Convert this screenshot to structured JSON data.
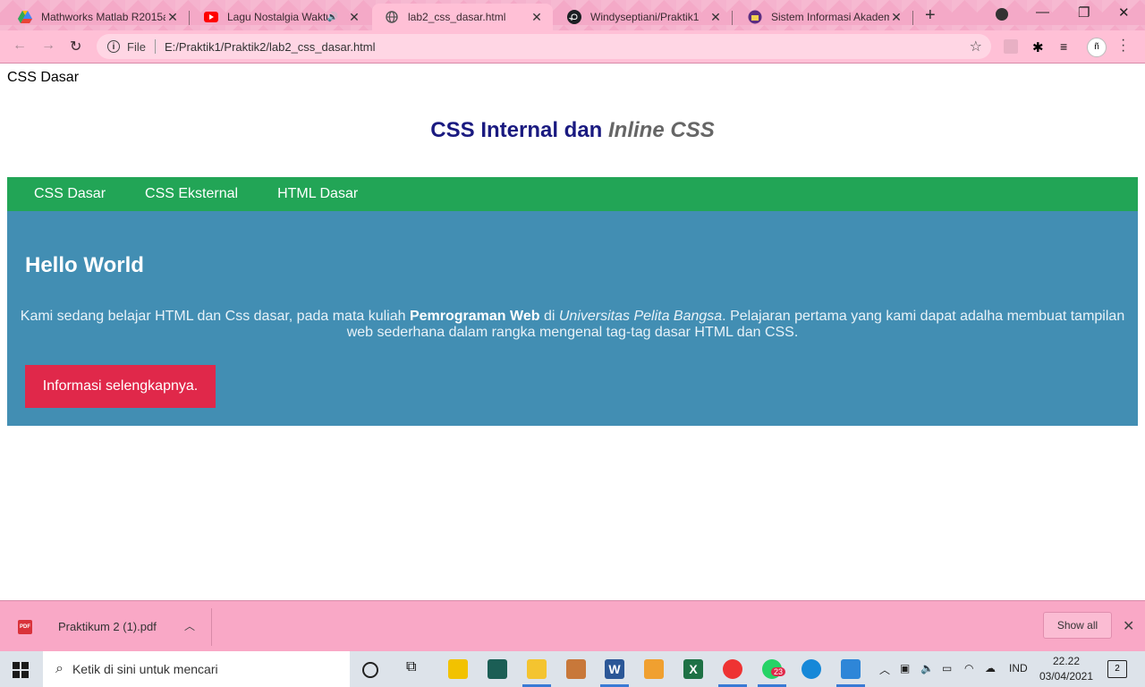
{
  "browser": {
    "tabs": [
      {
        "title": "Mathworks Matlab R2015a",
        "icon": "google-drive-icon"
      },
      {
        "title": "Lagu Nostalgia Waktu",
        "icon": "youtube-icon",
        "audio": true
      },
      {
        "title": "lab2_css_dasar.html",
        "icon": "globe-icon",
        "active": true
      },
      {
        "title": "Windyseptiani/Praktik1",
        "icon": "github-icon"
      },
      {
        "title": "Sistem Informasi Akademi",
        "icon": "university-icon"
      }
    ],
    "address": {
      "scheme_label": "File",
      "url": "E:/Praktik1/Praktik2/lab2_css_dasar.html"
    },
    "profile_initial": "ñ"
  },
  "page": {
    "doc_title": "CSS Dasar",
    "heading": {
      "normal": "CSS Internal dan",
      "italic": "Inline CSS"
    },
    "nav": [
      "CSS Dasar",
      "CSS Eksternal",
      "HTML Dasar"
    ],
    "hero": {
      "title": "Hello World",
      "text_1": "Kami sedang belajar HTML dan Css dasar, pada mata kuliah ",
      "text_bold": "Pemrograman Web",
      "text_2": " di ",
      "text_italic": "Universitas Pelita Bangsa",
      "text_3": ". Pelajaran pertama yang kami dapat adalha membuat tampilan web sederhana dalam rangka mengenal tag-tag dasar HTML dan CSS.",
      "button_label": "Informasi selengkapnya."
    }
  },
  "downloads": {
    "file_name": "Praktikum 2 (1).pdf",
    "file_icon": "pdf-icon",
    "show_all_label": "Show all"
  },
  "taskbar": {
    "search_placeholder": "Ketik di sini untuk mencari",
    "language": "IND",
    "time": "22.22",
    "date": "03/04/2021",
    "notification_count": "2",
    "whatsapp_badge": "23"
  },
  "colors": {
    "nav_bg": "#22a556",
    "hero_bg": "#428eb3",
    "button_bg": "#e0284a",
    "heading_color": "#1a1a80"
  }
}
